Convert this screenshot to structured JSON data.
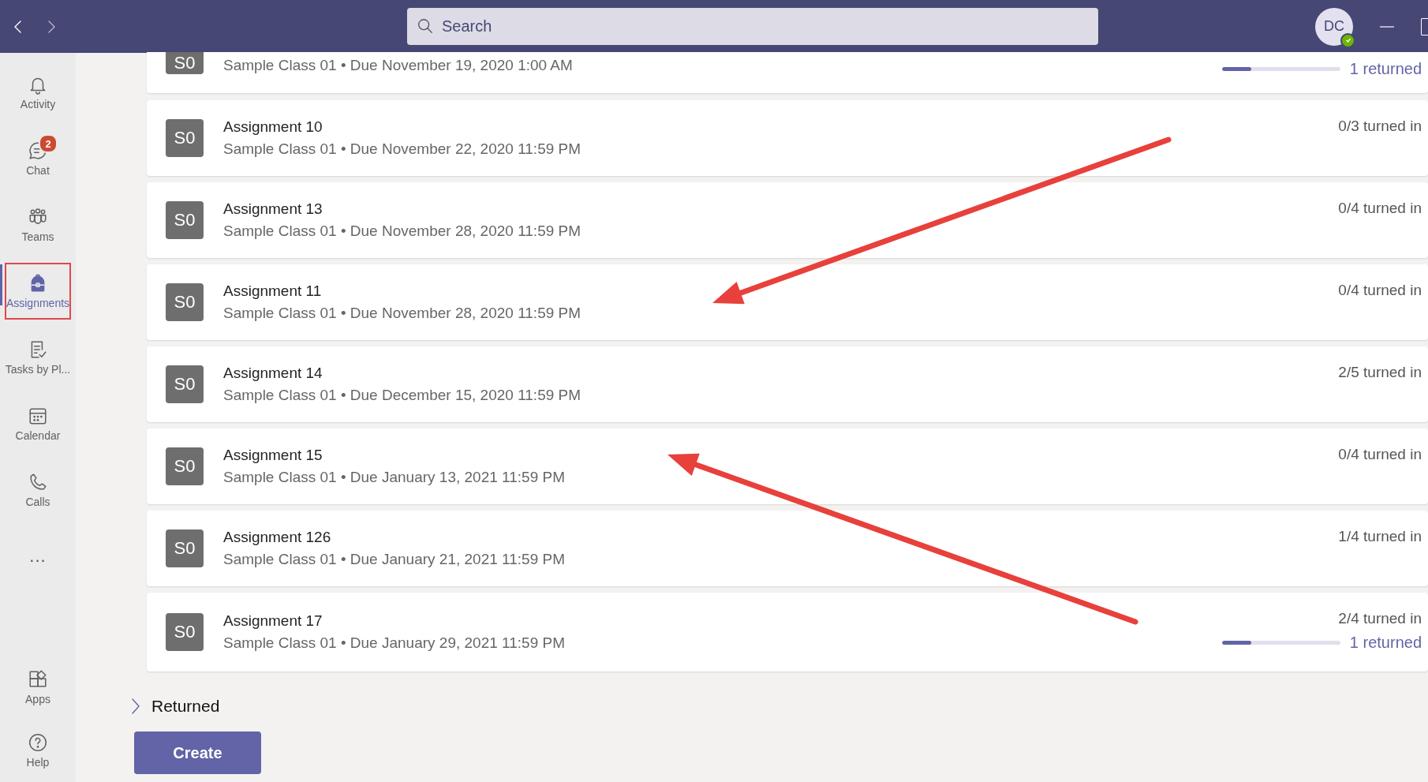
{
  "title_bar": {
    "search": {
      "placeholder": "Search"
    },
    "avatar": {
      "initials": "DC",
      "online": true
    }
  },
  "rail": {
    "items": [
      {
        "label": "Activity",
        "kind": "bell",
        "selected": false,
        "highlighted": false
      },
      {
        "label": "Chat",
        "kind": "chat",
        "selected": false,
        "highlighted": false,
        "badge": "2"
      },
      {
        "label": "Teams",
        "kind": "teams",
        "selected": false,
        "highlighted": false
      },
      {
        "label": "Assignments",
        "kind": "backpack",
        "selected": true,
        "highlighted": true
      },
      {
        "label": "Tasks by Pl...",
        "kind": "tasks",
        "selected": false,
        "highlighted": false
      },
      {
        "label": "Calendar",
        "kind": "calendar",
        "selected": false,
        "highlighted": false
      },
      {
        "label": "Calls",
        "kind": "phone",
        "selected": false,
        "highlighted": false
      },
      {
        "label": "...",
        "kind": "more",
        "selected": false,
        "highlighted": false
      }
    ],
    "bottom_items": [
      {
        "label": "Apps",
        "kind": "apps"
      },
      {
        "label": "Help",
        "kind": "help"
      }
    ]
  },
  "assignments": [
    {
      "class_avatar": "S0",
      "subtitle": "Sample Class 01 • Due November 19, 2020 1:00 AM",
      "returned": "1 returned",
      "level": 0.25
    },
    {
      "class_avatar": "S0",
      "title": "Assignment 10",
      "subtitle": "Sample Class 01 • Due November 22, 2020 11:59 PM",
      "turned_in": "0/3 turned in"
    },
    {
      "class_avatar": "S0",
      "title": "Assignment 13",
      "subtitle": "Sample Class 01 • Due November 28, 2020 11:59 PM",
      "turned_in": "0/4 turned in"
    },
    {
      "class_avatar": "S0",
      "title": "Assignment 11",
      "subtitle": "Sample Class 01 • Due November 28, 2020 11:59 PM",
      "turned_in": "0/4 turned in"
    },
    {
      "class_avatar": "S0",
      "title": "Assignment 14",
      "subtitle": "Sample Class 01 • Due December 15, 2020 11:59 PM",
      "turned_in": "2/5 turned in"
    },
    {
      "class_avatar": "S0",
      "title": "Assignment 15",
      "subtitle": "Sample Class 01 • Due January 13, 2021 11:59 PM",
      "turned_in": "0/4 turned in"
    },
    {
      "class_avatar": "S0",
      "title": "Assignment 126",
      "subtitle": "Sample Class 01 • Due January 21, 2021 11:59 PM",
      "turned_in": "1/4 turned in"
    },
    {
      "class_avatar": "S0",
      "title": "Assignment 17",
      "subtitle": "Sample Class 01 • Due January 29, 2021 11:59 PM",
      "turned_in": "2/4 turned in",
      "returned": "1 returned",
      "level": 0.25
    }
  ],
  "returned_section": {
    "label": "Returned",
    "expanded": false
  },
  "create_button": "Create",
  "annotations": [
    {
      "kind": "arrow"
    },
    {
      "kind": "arrow"
    }
  ]
}
